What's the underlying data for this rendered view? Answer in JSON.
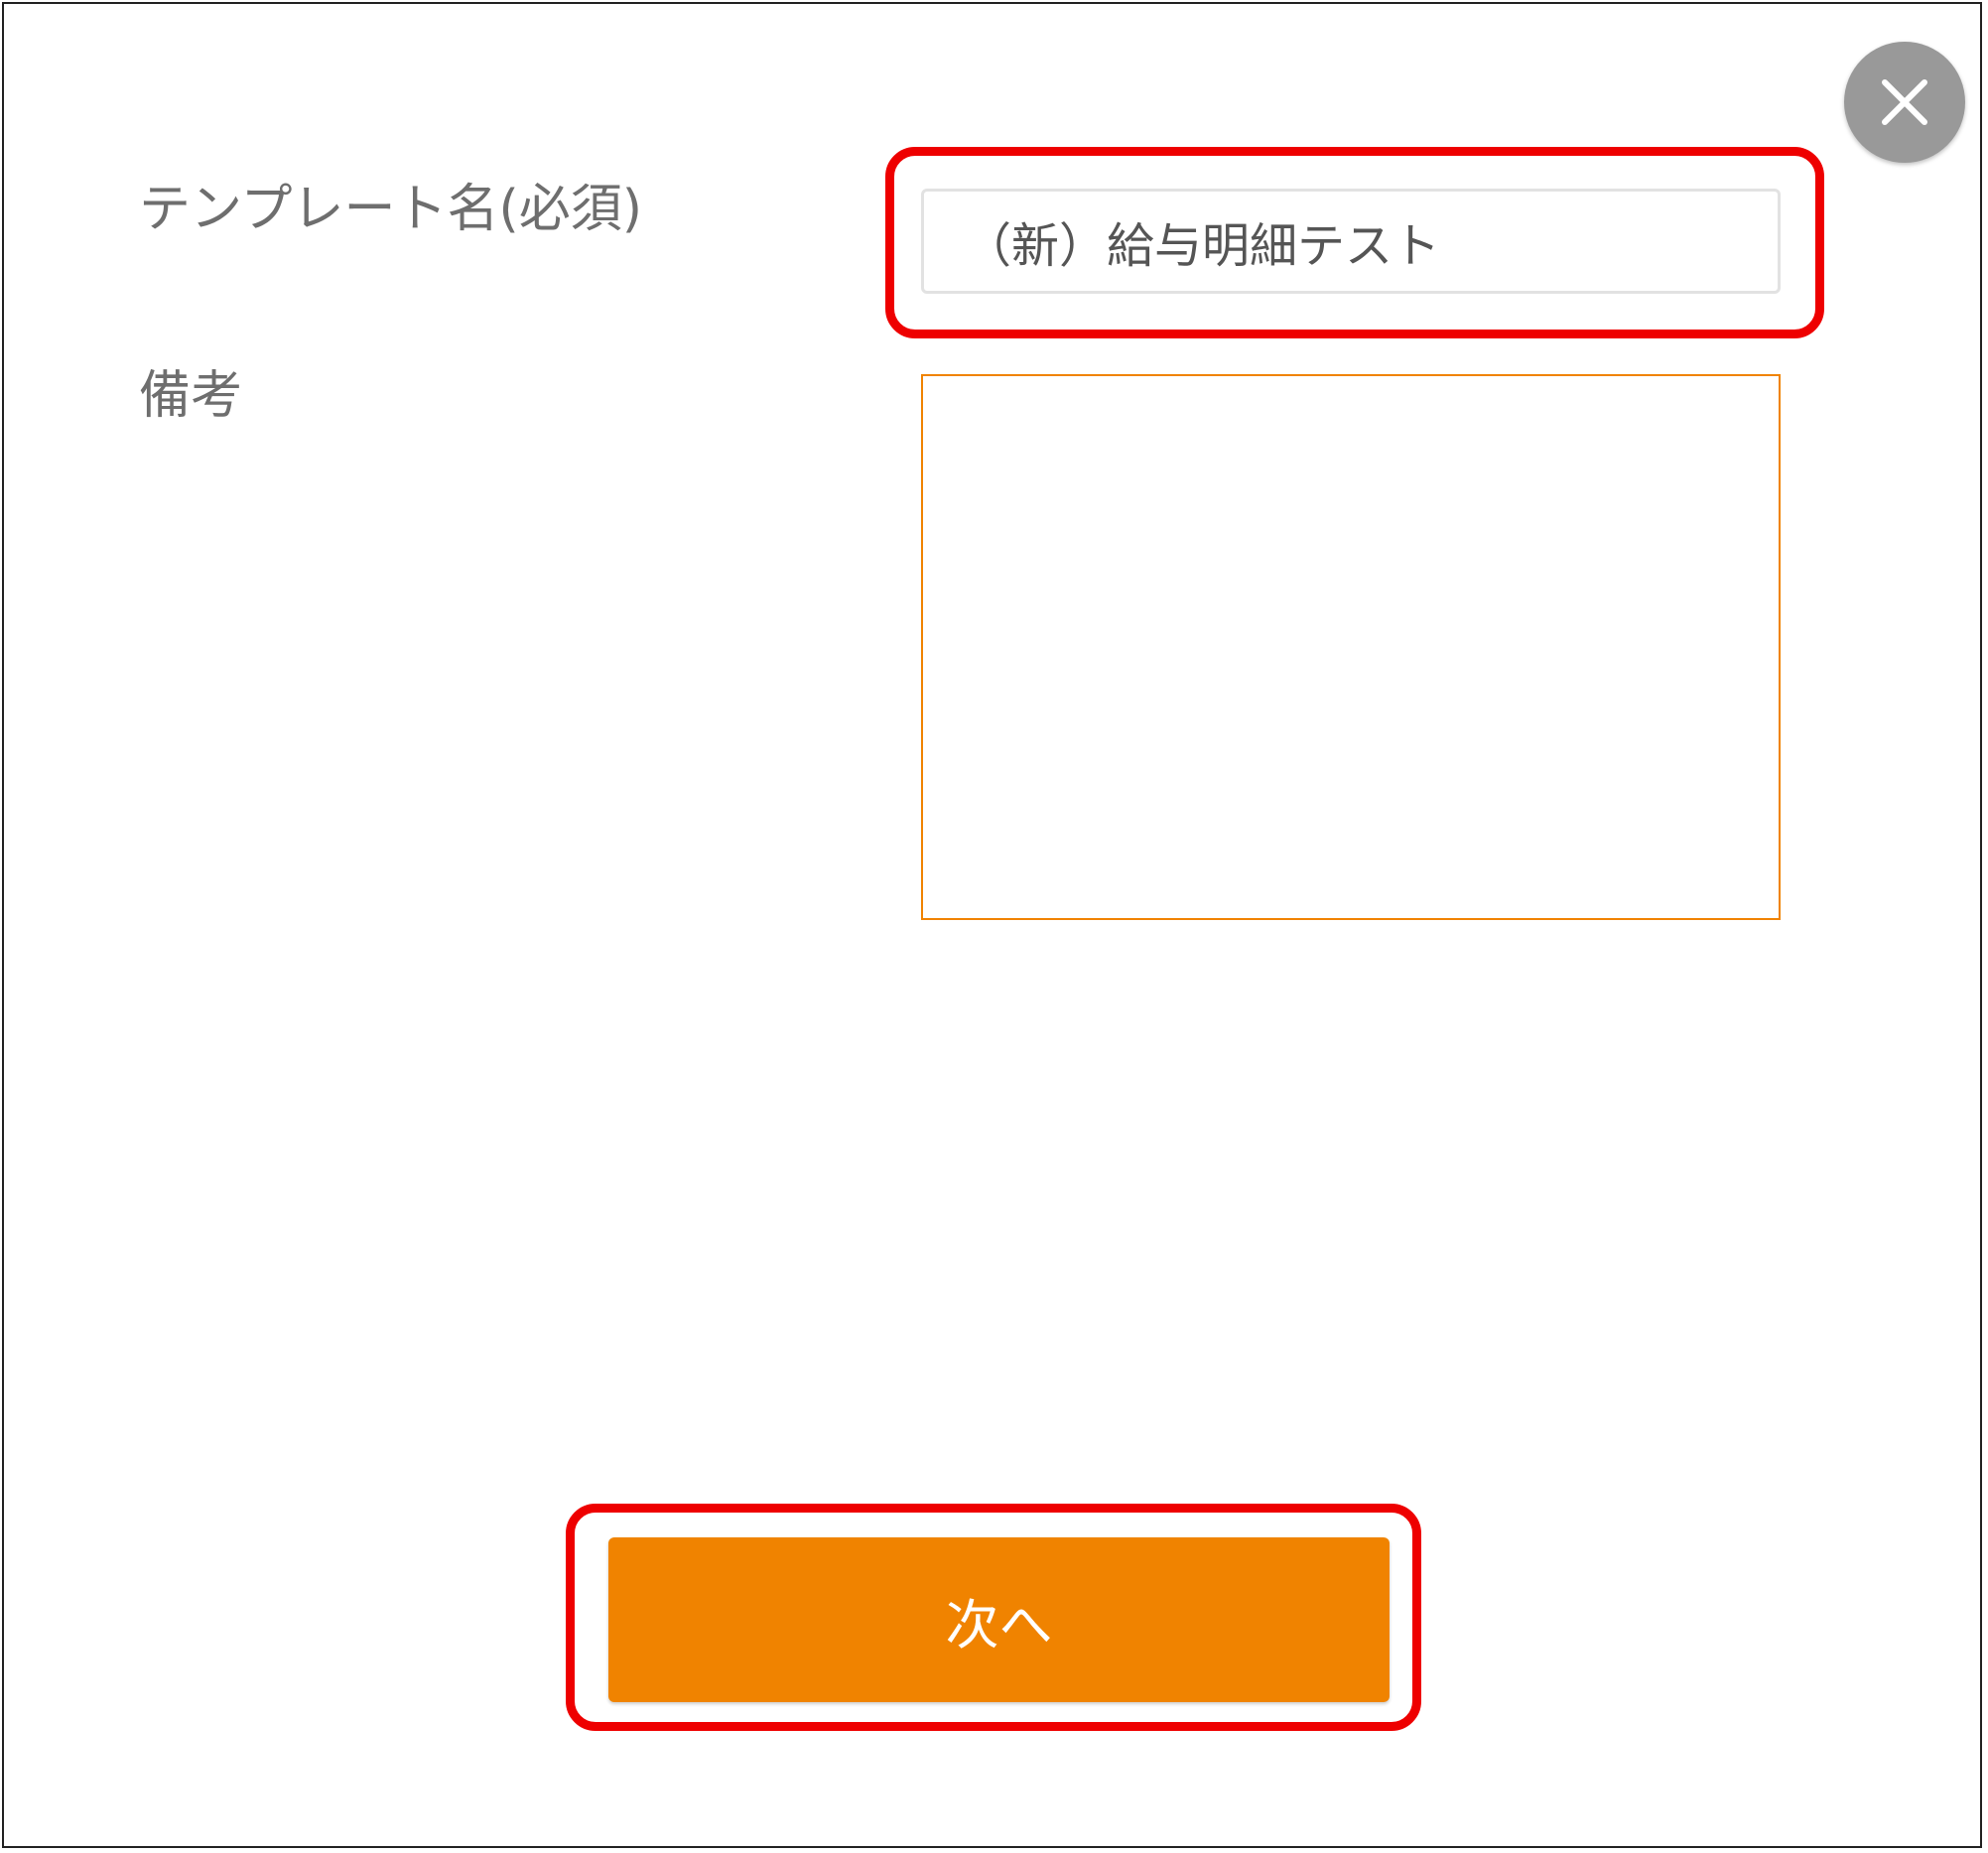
{
  "dialog": {
    "close_icon": "close-icon",
    "fields": {
      "template_name": {
        "label": "テンプレート名(必須)",
        "value": "（新）給与明細テスト"
      },
      "remarks": {
        "label": "備考",
        "value": ""
      }
    },
    "next_button_label": "次へ"
  },
  "colors": {
    "accent": "#f08300",
    "highlight": "#ee0000",
    "close_button": "#999999",
    "label_text": "#6e6e6e"
  }
}
